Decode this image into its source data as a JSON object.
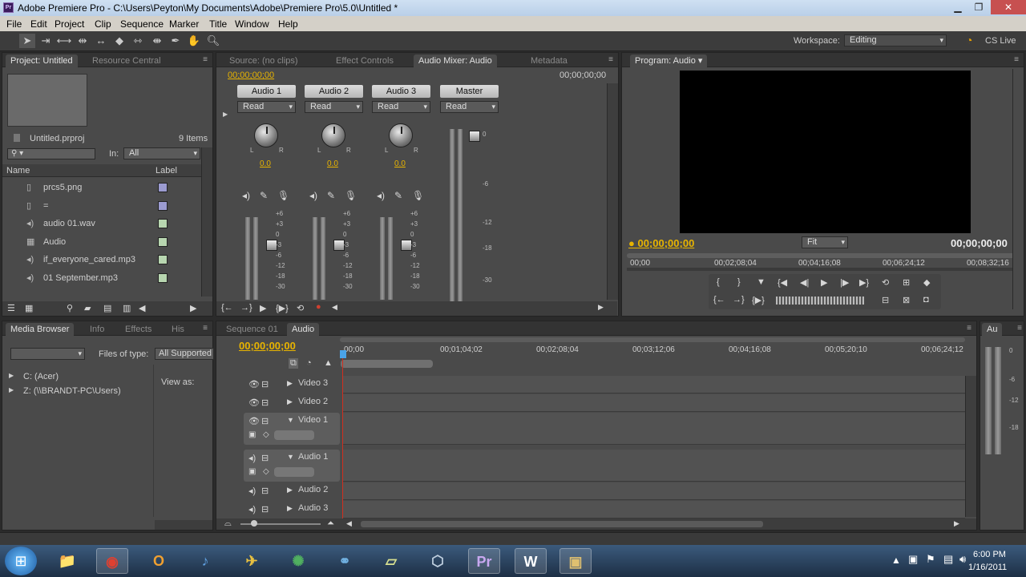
{
  "window": {
    "title": "Adobe Premiere Pro - C:\\Users\\Peyton\\My Documents\\Adobe\\Premiere Pro\\5.0\\Untitled *",
    "app_icon": "Pr"
  },
  "menu": [
    "File",
    "Edit",
    "Project",
    "Clip",
    "Sequence",
    "Marker",
    "Title",
    "Window",
    "Help"
  ],
  "workspace": {
    "label": "Workspace:",
    "value": "Editing",
    "cslive": "CS Live"
  },
  "project_panel": {
    "tabs": [
      "Project: Untitled",
      "Resource Central"
    ],
    "file": "Untitled.prproj",
    "count": "9 Items",
    "in_label": "In:",
    "in_value": "All",
    "col_name": "Name",
    "col_label": "Label",
    "items": [
      {
        "name": "prcs5.png",
        "icon": "image-file-icon",
        "color": "#9b9bd0"
      },
      {
        "name": "=",
        "icon": "image-file-icon",
        "color": "#9b9bd0"
      },
      {
        "name": "audio 01.wav",
        "icon": "audio-file-icon",
        "color": "#b8d6b0"
      },
      {
        "name": "Audio",
        "icon": "sequence-icon",
        "color": "#b8d6b0"
      },
      {
        "name": "if_everyone_cared.mp3",
        "icon": "audio-file-icon",
        "color": "#b8d6b0"
      },
      {
        "name": "01 September.mp3",
        "icon": "audio-file-icon",
        "color": "#b8d6b0"
      }
    ]
  },
  "mixer_panel": {
    "tabs": [
      "Source: (no clips)",
      "Effect Controls",
      "Audio Mixer: Audio",
      "Metadata"
    ],
    "timecode_left": "00;00;00;00",
    "timecode_right": "00;00;00;00",
    "channels": [
      {
        "name": "Audio 1",
        "mode": "Read",
        "pan": "0.0"
      },
      {
        "name": "Audio 2",
        "mode": "Read",
        "pan": "0.0"
      },
      {
        "name": "Audio 3",
        "mode": "Read",
        "pan": "0.0"
      }
    ],
    "master": {
      "name": "Master",
      "mode": "Read"
    },
    "scale": [
      "+6",
      "+3",
      "0",
      "-3",
      "-6",
      "-12",
      "-18",
      "-30"
    ],
    "master_scale": [
      "0",
      "-6",
      "-12",
      "-18",
      "-30"
    ],
    "knob_lr": [
      "L",
      "R"
    ]
  },
  "program_panel": {
    "tab": "Program: Audio",
    "timecode": "00;00;00;00",
    "duration": "00;00;00;00",
    "fit": "Fit",
    "ruler": [
      "00;00",
      "00;02;08;04",
      "00;04;16;08",
      "00;06;24;12",
      "00;08;32;16"
    ]
  },
  "media_panel": {
    "tabs": [
      "Media Browser",
      "Info",
      "Effects",
      "His"
    ],
    "files_of_type": "Files of type:",
    "type_value": "All Supported",
    "view_as": "View as:",
    "drives": [
      "C: (Acer)",
      "Z: (\\\\BRANDT-PC\\Users)"
    ]
  },
  "timeline_panel": {
    "tabs": [
      "Sequence 01",
      "Audio"
    ],
    "timecode": "00;00;00;00",
    "ruler": [
      "00;00",
      "00;01;04;02",
      "00;02;08;04",
      "00;03;12;06",
      "00;04;16;08",
      "00;05;20;10",
      "00;06;24;12"
    ],
    "tracks": [
      "Video 3",
      "Video 2",
      "Video 1",
      "Audio 1",
      "Audio 2",
      "Audio 3"
    ]
  },
  "audio_meter_panel": {
    "tab": "Au",
    "scale": [
      "0",
      "-6",
      "-12",
      "-18"
    ]
  },
  "taskbar": {
    "apps": [
      {
        "name": "windows-explorer",
        "glyph": "📁",
        "color": "#e8c060"
      },
      {
        "name": "chrome",
        "glyph": "◉",
        "color": "#e04030"
      },
      {
        "name": "outlook",
        "glyph": "O",
        "color": "#f0a030"
      },
      {
        "name": "itunes",
        "glyph": "♪",
        "color": "#60a0e0"
      },
      {
        "name": "app-bird",
        "glyph": "✈",
        "color": "#e8c040"
      },
      {
        "name": "app-globe",
        "glyph": "✺",
        "color": "#50b060"
      },
      {
        "name": "app-network",
        "glyph": "⚭",
        "color": "#70b0e0"
      },
      {
        "name": "sticky-notes",
        "glyph": "▱",
        "color": "#d8e090"
      },
      {
        "name": "app-cube",
        "glyph": "⬡",
        "color": "#c0d0e0"
      },
      {
        "name": "premiere",
        "glyph": "Pr",
        "color": "#c8a8f0"
      },
      {
        "name": "word",
        "glyph": "W",
        "color": "#ffffff"
      },
      {
        "name": "video-app",
        "glyph": "▣",
        "color": "#e0c070"
      }
    ],
    "time": "6:00 PM",
    "date": "1/16/2011"
  }
}
